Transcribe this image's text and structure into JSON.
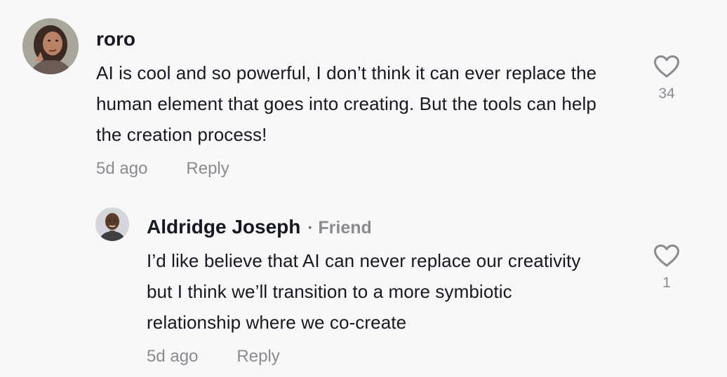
{
  "comments": [
    {
      "author": "roro",
      "text": "AI is cool and so powerful, I don’t think it can ever replace the human element that goes into creating. But the tools can help the creation process!",
      "time": "5d ago",
      "reply_label": "Reply",
      "likes": "34",
      "icons": {
        "like": "heart-outline-icon"
      }
    },
    {
      "author": "Aldridge Joseph",
      "separator": "·",
      "tag": "Friend",
      "text": "I’d like believe that AI can never replace our creativity but I think we’ll transition to a more symbiotic relationship where we co-create",
      "time": "5d ago",
      "reply_label": "Reply",
      "likes": "1",
      "icons": {
        "like": "heart-outline-icon"
      }
    }
  ],
  "colors": {
    "background": "#f8f8f8",
    "primary_text": "#161823",
    "secondary_text": "#8a8b91"
  }
}
